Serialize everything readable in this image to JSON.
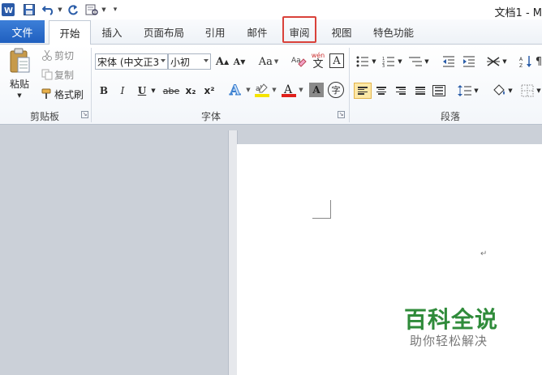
{
  "window": {
    "title": "文档1 - M"
  },
  "tabs": {
    "file": "文件",
    "home": "开始",
    "insert": "插入",
    "layout": "页面布局",
    "references": "引用",
    "mailings": "邮件",
    "review": "审阅",
    "view": "视图",
    "special": "特色功能"
  },
  "clipboard": {
    "paste": "粘贴",
    "cut": "剪切",
    "copy": "复制",
    "format_painter": "格式刷",
    "label": "剪贴板"
  },
  "font": {
    "name": "宋体 (中文正3",
    "size": "小初",
    "case": "Aa",
    "label": "字体",
    "bold": "B",
    "italic": "I",
    "underline": "U",
    "strike": "abe",
    "subscript": "x₂",
    "superscript": "x²",
    "grow": "A",
    "shrink": "A",
    "highlight_color": "#f5e400",
    "font_color": "#e0201b",
    "phonetic_top": "wén",
    "phonetic_char": "文",
    "border_char": "A",
    "shade_char": "A",
    "enclose_char": "字"
  },
  "paragraph": {
    "label": "段落"
  },
  "watermark": {
    "main": "百科全说",
    "sub": "助你轻松解决"
  },
  "document": {
    "paragraph_mark": "↵"
  },
  "colors": {
    "file_tab": "#2a6bc9",
    "review_highlight": "#d9413a",
    "watermark_green": "#2f8b3a"
  }
}
